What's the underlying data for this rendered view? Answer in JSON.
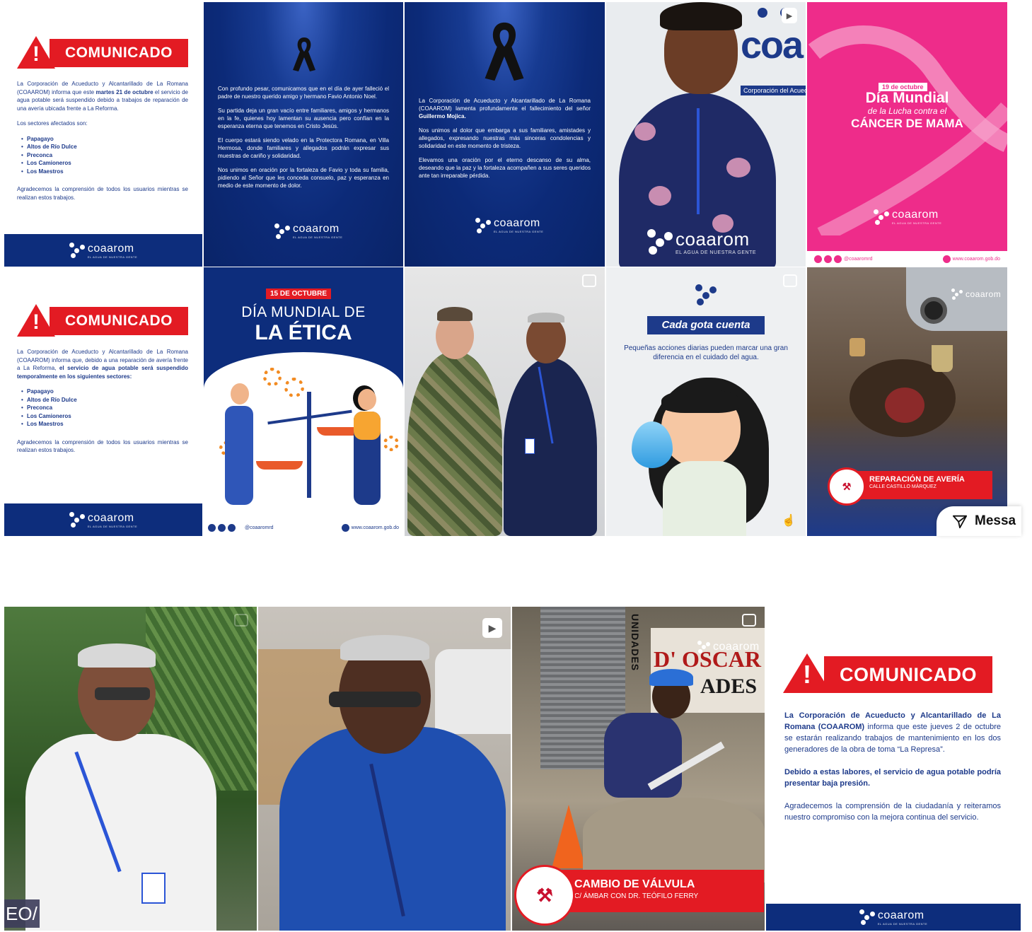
{
  "brand": {
    "logo_text": "coaarom",
    "tagline": "EL AGUA DE NUESTRA GENTE",
    "tagline_small": "EL AGUA DE NUESTRA GENTE",
    "social_handle": "@coaaromrd",
    "website": "www.coaarom.gob.do",
    "colors": {
      "navy": "#0d2d7c",
      "red": "#e31b23",
      "pink": "#ee2c8a"
    }
  },
  "posts": {
    "comunicado1": {
      "badge": "COMUNICADO",
      "p1_a": "La Corporación de Acueducto y Alcantarillado de La Romana (COAAROM) informa que este ",
      "p1_b": "martes 21 de octubre",
      "p1_c": " el servicio de agua potable será suspendido debido a trabajos de reparación de una avería ubicada frente a La Reforma.",
      "p2": "Los sectores afectados son:",
      "sectors": [
        "Papagayo",
        "Altos de Río Dulce",
        "Preconca",
        "Los Camioneros",
        "Los Maestros"
      ],
      "p3": "Agradecemos la comprensión de todos los usuarios mientras se realizan estos trabajos."
    },
    "condolencia1": {
      "p1": "Con profundo pesar, comunicamos que en el día de ayer falleció el padre de nuestro querido amigo y hermano Favio Antonio Noel.",
      "p2": "Su partida deja un gran vacío entre familiares, amigos y hermanos en la fe, quienes hoy lamentan su ausencia pero confían en la esperanza eterna que tenemos en Cristo Jesús.",
      "p3": "El cuerpo estará siendo velado en la Protectora Romana, en Villa Hermosa, donde familiares y allegados podrán expresar sus muestras de cariño y solidaridad.",
      "p4": "Nos unimos en oración por la fortaleza de Favio y toda su familia, pidiendo al Señor que les conceda consuelo, paz y esperanza en medio de este momento de dolor."
    },
    "condolencia2": {
      "p1_a": "La Corporación de Acueducto y Alcantarillado de La Romana (COAAROM) lamenta profundamente el fallecimiento del señor ",
      "p1_b": "Guillermo Mojica.",
      "p2": "Nos unimos al dolor que embarga a sus familiares, amistades y allegados, expresando nuestras más sinceras condolencias y solidaridad en este momento de tristeza.",
      "p3": "Elevamos una oración por el eterno descanso de su alma, deseando que la paz y la fortaleza acompañen a sus seres queridos ante tan irreparable pérdida."
    },
    "video_woman": {
      "wall_sign": "coa",
      "wall_sign_sub": "Corporación del Acued",
      "logo": "coaarom",
      "tagline": "EL AGUA DE NUESTRA GENTE"
    },
    "cancer": {
      "date": "19 de octubre",
      "l1": "Día Mundial",
      "l2": "de la Lucha contra el",
      "l3": "CÁNCER DE MAMA"
    },
    "comunicado2": {
      "badge": "COMUNICADO",
      "p1_a": "La Corporación de Acueducto y Alcantarillado de La Romana (COAAROM) informa que, debido a una reparación de avería frente a La Reforma, ",
      "p1_b": "el servicio de agua potable será suspendido temporalmente en los siguientes sectores:",
      "sectors": [
        "Papagayo",
        "Altos de Río Dulce",
        "Preconca",
        "Los Camioneros",
        "Los Maestros"
      ],
      "p3": "Agradecemos la comprensión de todos los usuarios mientras se realizan estos trabajos."
    },
    "etica": {
      "date": "15 DE OCTUBRE",
      "l1": "DÍA MUNDIAL DE",
      "l2": "LA ÉTICA"
    },
    "gota": {
      "title": "Cada gota cuenta",
      "subtitle": "Pequeñas acciones diarias pueden marcar una gran diferencia en el cuidado del agua."
    },
    "averia": {
      "title": "REPARACIÓN DE AVERÍA",
      "subtitle": "CALLE CASTILLO MÁRQUEZ",
      "logo": "coaarom"
    },
    "valvula": {
      "title": "CAMBIO DE VÁLVULA",
      "subtitle": "C/ ÁMBAR CON DR. TEÓFILO FERRY",
      "shop_sign": "D' OSCAR",
      "shop_sign2": "ADES",
      "shop_side": "UNIDADES",
      "logo": "coaarom"
    },
    "comunicado3": {
      "badge": "COMUNICADO",
      "p1_a": "La Corporación de Acueducto y Alcantarillado de La Romana (COAAROM)",
      "p1_b": " informa que este jueves 2 de octubre se estarán realizando trabajos de mantenimiento en los dos generadores de la obra de toma “La Represa”.",
      "p2": "Debido a estas labores, el servicio de agua potable podría presentar baja presión.",
      "p3": "Agradecemos la comprensión de la ciudadanía y reiteramos nuestro compromiso con la mejora continua del servicio."
    },
    "video_label": "EO/"
  },
  "message_button": {
    "label": "Messa"
  }
}
